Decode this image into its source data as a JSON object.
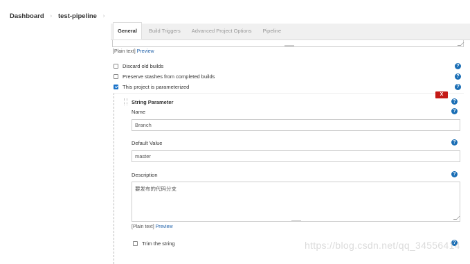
{
  "breadcrumb": {
    "items": [
      "Dashboard",
      "test-pipeline"
    ],
    "separator": "›"
  },
  "tabs": [
    {
      "label": "General",
      "active": true
    },
    {
      "label": "Build Triggers",
      "active": false
    },
    {
      "label": "Advanced Project Options",
      "active": false
    },
    {
      "label": "Pipeline",
      "active": false
    }
  ],
  "top_plain": {
    "prefix": "[Plain text]",
    "link": "Preview"
  },
  "options": [
    {
      "label": "Discard old builds",
      "checked": false
    },
    {
      "label": "Preserve stashes from completed builds",
      "checked": false
    },
    {
      "label": "This project is parameterized",
      "checked": true
    }
  ],
  "help_glyph": "?",
  "param": {
    "close_label": "X",
    "title": "String Parameter",
    "name_label": "Name",
    "name_value": "Branch",
    "default_label": "Default Value",
    "default_value": "master",
    "desc_label": "Description",
    "desc_value": "要发布的代码分支",
    "plain_prefix": "[Plain text]",
    "plain_link": "Preview",
    "trim_label": "Trim the string",
    "trim_checked": false
  },
  "watermark": "https://blog.csdn.net/qq_34556414",
  "colors": {
    "help_blue": "#1a6eb5",
    "close_red": "#c41a16",
    "link_blue": "#1d5fa8",
    "check_blue": "#1a73c9"
  }
}
